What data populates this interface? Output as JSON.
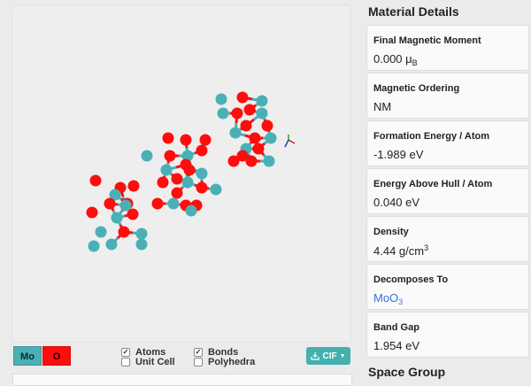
{
  "viewer": {
    "legend": [
      {
        "label": "Mo",
        "color": "#4ab0b6"
      },
      {
        "label": "O",
        "color": "#ff0d0d"
      }
    ],
    "toggles": {
      "atoms": {
        "label": "Atoms",
        "checked": true
      },
      "unit_cell": {
        "label": "Unit Cell",
        "checked": false
      },
      "bonds": {
        "label": "Bonds",
        "checked": true
      },
      "polyhedra": {
        "label": "Polyhedra",
        "checked": false
      }
    },
    "download_label": "CIF"
  },
  "details": {
    "title": "Material Details",
    "items": [
      {
        "label": "Final Magnetic Moment",
        "value": "0.000 μ",
        "sub": "B"
      },
      {
        "label": "Magnetic Ordering",
        "value": "NM"
      },
      {
        "label": "Formation Energy / Atom",
        "value": "-1.989 eV"
      },
      {
        "label": "Energy Above Hull / Atom",
        "value": "0.040 eV"
      },
      {
        "label": "Density",
        "value": "4.44 g/cm",
        "sup": "3"
      },
      {
        "label": "Decomposes To",
        "value": "MoO",
        "sub": "3"
      },
      {
        "label": "Band Gap",
        "value": "1.954 eV"
      }
    ],
    "next_section": "Space Group"
  }
}
